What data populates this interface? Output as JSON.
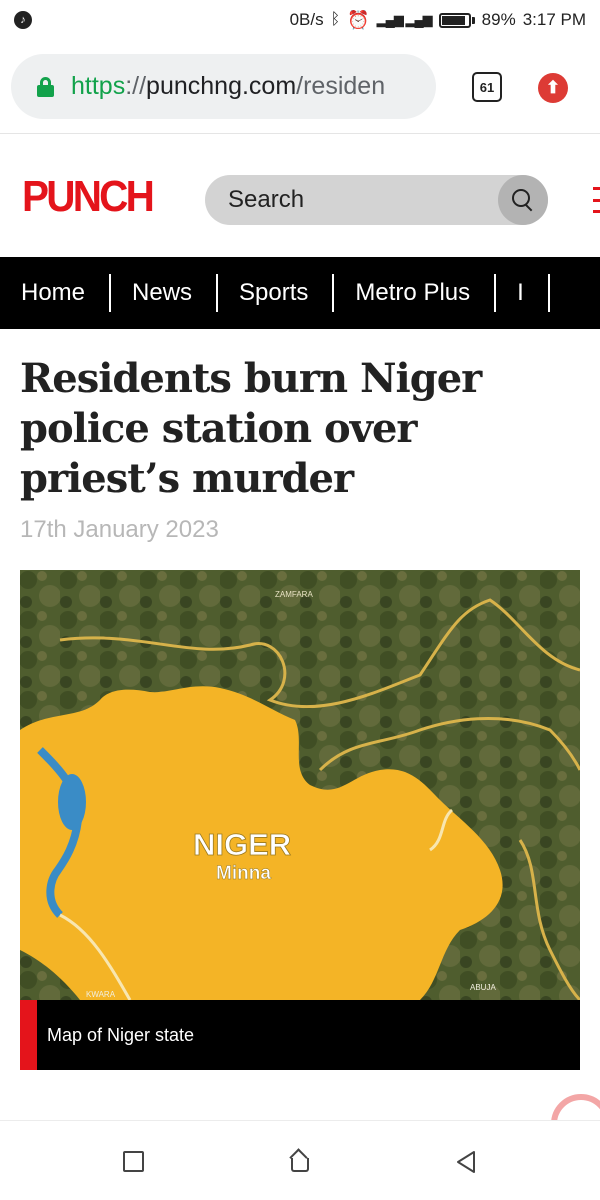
{
  "status_bar": {
    "data_speed": "0B/s",
    "battery_percent": "89%",
    "battery_level": 0.89,
    "time": "3:17 PM",
    "icons": [
      "music-icon",
      "bluetooth-icon",
      "alarm-icon",
      "signal-icon",
      "battery-icon"
    ]
  },
  "browser": {
    "url_scheme": "https",
    "url_sep": "://",
    "url_host": "punchng.com",
    "url_path": "/residen",
    "tab_count": "61",
    "colors": {
      "lock": "#12a24b",
      "upload": "#dd3b35"
    }
  },
  "header": {
    "logo_text": "PUNCH",
    "search_label": "Search",
    "brand_color": "#e4141b"
  },
  "nav": {
    "items": [
      "Home",
      "News",
      "Sports",
      "Metro Plus",
      "I"
    ]
  },
  "article": {
    "headline": "Residents burn Niger police station over priest’s murder",
    "date": "17th January 2023",
    "image": {
      "labels": {
        "zamfara": "ZAMFARA",
        "niger": "NIGER",
        "minna": "Minna",
        "kwara": "KWARA",
        "abuja": "ABUJA"
      },
      "caption": "Map of Niger state"
    }
  }
}
